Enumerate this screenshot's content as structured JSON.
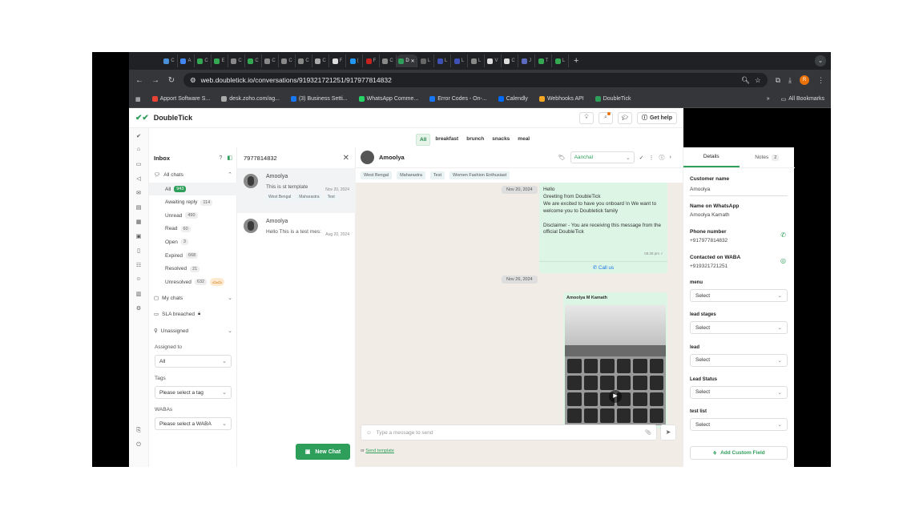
{
  "browser": {
    "tabs": [
      {
        "label": "C",
        "color": "#4a90d9"
      },
      {
        "label": "A",
        "color": "#4285f4"
      },
      {
        "label": "C",
        "color": "#34a853"
      },
      {
        "label": "E",
        "color": "#34a853"
      },
      {
        "label": "C",
        "color": "#888888"
      },
      {
        "label": "C",
        "color": "#34a853"
      },
      {
        "label": "C",
        "color": "#888888"
      },
      {
        "label": "C",
        "color": "#888888"
      },
      {
        "label": "C",
        "color": "#888888"
      },
      {
        "label": "C",
        "color": "#aaaaaa"
      },
      {
        "label": "F",
        "color": "#dddddd"
      },
      {
        "label": "(",
        "color": "#2196f3"
      },
      {
        "label": "F",
        "color": "#c5221f"
      },
      {
        "label": "C",
        "color": "#888888"
      },
      {
        "label": "D",
        "color": "#2e9e5b",
        "active": true
      },
      {
        "label": "L",
        "color": "#666666"
      },
      {
        "label": "L",
        "color": "#3f51b5"
      },
      {
        "label": "L",
        "color": "#3f51b5"
      },
      {
        "label": "L",
        "color": "#888888"
      },
      {
        "label": "V",
        "color": "#dddddd"
      },
      {
        "label": "C",
        "color": "#dddddd"
      },
      {
        "label": "J",
        "color": "#5c6bc0"
      },
      {
        "label": "T",
        "color": "#34a853"
      },
      {
        "label": "L",
        "color": "#34a853"
      }
    ],
    "new_tab": "+",
    "url": "web.doubletick.io/conversations/919321721251/917977814832",
    "profile_initial": "R",
    "bookmarks": [
      {
        "label": "Apport Software S...",
        "color": "#ea4335"
      },
      {
        "label": "desk.zoho.com/ag...",
        "color": "#aaaaaa"
      },
      {
        "label": "(3) Business Setti...",
        "color": "#1877f2"
      },
      {
        "label": "WhatsApp Comme...",
        "color": "#25d366"
      },
      {
        "label": "Error Codes - On-...",
        "color": "#1877f2"
      },
      {
        "label": "Calendly",
        "color": "#006bff"
      },
      {
        "label": "Webhooks API",
        "color": "#f5a623"
      },
      {
        "label": "DoubleTick",
        "color": "#2e9e5b"
      }
    ],
    "more": "»",
    "all_bookmarks": "All Bookmarks"
  },
  "app": {
    "title": "DoubleTick",
    "help_label": "Get help",
    "accent": "#2e9e5b"
  },
  "pills": [
    "All",
    "breakfast",
    "brunch",
    "snacks",
    "meal"
  ],
  "sidebar": {
    "title": "Inbox",
    "all_chats": "All chats",
    "filters": [
      {
        "label": "All",
        "count": "943"
      },
      {
        "label": "Awaiting reply",
        "count": "114"
      },
      {
        "label": "Unread",
        "count": "490"
      },
      {
        "label": "Read",
        "count": "60"
      },
      {
        "label": "Open",
        "count": "3"
      },
      {
        "label": "Expired",
        "count": "668"
      },
      {
        "label": "Resolved",
        "count": "21"
      },
      {
        "label": "Unresolved",
        "count": "632"
      }
    ],
    "unresolved_badge": "ᯅᯅ",
    "my_chats": "My chats",
    "sla": "SLA breached",
    "unassigned": "Unassigned",
    "assigned_to_label": "Assigned to",
    "assigned_to_value": "All",
    "tags_label": "Tags",
    "tags_placeholder": "Please select a tag",
    "wabas_label": "WABAs",
    "wabas_placeholder": "Please select a WABA"
  },
  "chatlist": {
    "search_value": "7977814832",
    "items": [
      {
        "name": "Amoolya",
        "snippet": "This is st template",
        "date": "Nov 20, 2024",
        "tags": [
          "West Bengal",
          "Maharastra",
          "Test"
        ]
      },
      {
        "name": "Amoolya",
        "snippet": "Hello This is a test mes:",
        "date": "Aug 20, 2024",
        "tags": []
      }
    ],
    "new_chat_label": "New Chat"
  },
  "conversation": {
    "name": "Amoolya",
    "assignee": "Aanchal",
    "tags": [
      "West Bengal",
      "Maharastra",
      "Test",
      "Women Fashion Enthusiast"
    ],
    "date1": "Nov 20, 2024",
    "msg1_lines": [
      "Hello",
      "Greeting from DoubleTick",
      "We are excited to have you onboard \\n We want to welcome you to Doubletick family",
      "",
      "Disclaimer - You are receiving this message from the official DoubleTick"
    ],
    "msg1_time": "06:28 pm ✓",
    "msg1_button": "Call us",
    "date2": "Nov 26, 2024",
    "msg2_sender": "Amoolya M Kamath",
    "composer_placeholder": "Type a message to send",
    "template_prefix": "or",
    "template_link": "Send template"
  },
  "details": {
    "tab_details": "Details",
    "tab_notes": "Notes",
    "notes_count": "2",
    "customer_name_label": "Customer name",
    "customer_name": "Amoolya",
    "wa_name_label": "Name on WhatsApp",
    "wa_name": "Amoolya Kamath",
    "phone_label": "Phone number",
    "phone": "+917977814832",
    "waba_label": "Contacted on WABA",
    "waba": "+919321721251",
    "fields": [
      {
        "label": "menu",
        "value": "Select"
      },
      {
        "label": "lead stages",
        "value": "Select"
      },
      {
        "label": "lead",
        "value": "Select"
      },
      {
        "label": "Lead Status",
        "value": "Select"
      },
      {
        "label": "test list",
        "value": "Select"
      }
    ],
    "add_field_label": "Add Custom Field"
  }
}
